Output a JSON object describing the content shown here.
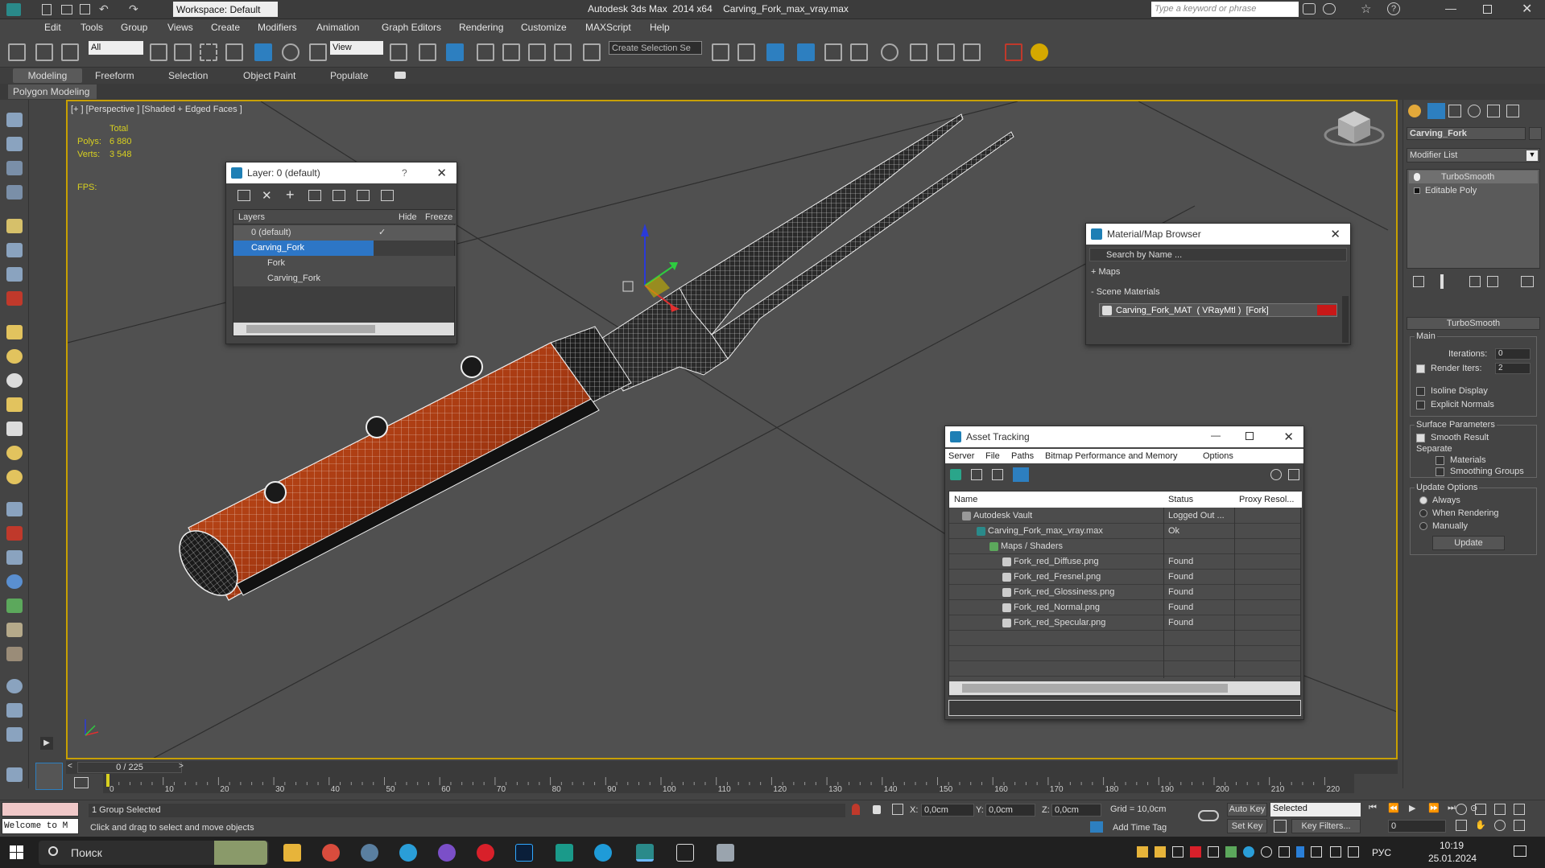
{
  "titlebar": {
    "workspace": "Workspace: Default",
    "title": "Autodesk 3ds Max  2014 x64    Carving_Fork_max_vray.max",
    "search_placeholder": "Type a keyword or phrase"
  },
  "menu": [
    "Edit",
    "Tools",
    "Group",
    "Views",
    "Create",
    "Modifiers",
    "Animation",
    "Graph Editors",
    "Rendering",
    "Customize",
    "MAXScript",
    "Help"
  ],
  "toolbar": {
    "filter": "All",
    "view": "View",
    "selection_set": "Create Selection Se"
  },
  "ribbon": {
    "tabs": [
      "Modeling",
      "Freeform",
      "Selection",
      "Object Paint",
      "Populate"
    ],
    "sub": "Polygon Modeling"
  },
  "viewport": {
    "label": "[+ ] [Perspective ] [Shaded + Edged Faces ]",
    "stats_total": "Total",
    "polys_label": "Polys:",
    "polys_value": "6 880",
    "verts_label": "Verts:",
    "verts_value": "3 548",
    "fps_label": "FPS:"
  },
  "layer_dialog": {
    "title": "Layer: 0 (default)",
    "help": "?",
    "col_layers": "Layers",
    "col_hide": "Hide",
    "col_freeze": "Freeze",
    "rows": [
      "0 (default)",
      "Carving_Fork",
      "Fork",
      "Carving_Fork"
    ]
  },
  "material_browser": {
    "title": "Material/Map Browser",
    "search_placeholder": "Search by Name ...",
    "maps": "+ Maps",
    "scene_materials": "- Scene Materials",
    "material": "Carving_Fork_MAT  ( VRayMtl )  [Fork]",
    "material_color": "#c81818"
  },
  "asset_tracking": {
    "title": "Asset Tracking",
    "menu": [
      "Server",
      "File",
      "Paths",
      "Bitmap Performance and Memory",
      "Options"
    ],
    "col_name": "Name",
    "col_status": "Status",
    "col_proxy": "Proxy Resol...",
    "rows": [
      {
        "name": "Autodesk Vault",
        "status": "Logged Out ..."
      },
      {
        "name": "Carving_Fork_max_vray.max",
        "status": "Ok"
      },
      {
        "name": "Maps / Shaders",
        "status": ""
      },
      {
        "name": "Fork_red_Diffuse.png",
        "status": "Found"
      },
      {
        "name": "Fork_red_Fresnel.png",
        "status": "Found"
      },
      {
        "name": "Fork_red_Glossiness.png",
        "status": "Found"
      },
      {
        "name": "Fork_red_Normal.png",
        "status": "Found"
      },
      {
        "name": "Fork_red_Specular.png",
        "status": "Found"
      }
    ]
  },
  "command_panel": {
    "object_name": "Carving_Fork",
    "modifier_list": "Modifier List",
    "stack": [
      "TurboSmooth",
      "Editable Poly"
    ],
    "rollout_title": "TurboSmooth",
    "main": "Main",
    "iterations_label": "Iterations:",
    "iterations_value": "0",
    "render_iters_label": "Render Iters:",
    "render_iters_value": "2",
    "isoline": "Isoline Display",
    "explicit_normals": "Explicit Normals",
    "surface_params": "Surface Parameters",
    "smooth_result": "Smooth Result",
    "separate": "Separate",
    "materials": "Materials",
    "smoothing_groups": "Smoothing Groups",
    "update_options": "Update Options",
    "always": "Always",
    "when_rendering": "When Rendering",
    "manually": "Manually",
    "update_btn": "Update"
  },
  "timeline": {
    "frame": "0 / 225",
    "ticks": [
      "0",
      "10",
      "20",
      "30",
      "40",
      "50",
      "60",
      "70",
      "80",
      "90",
      "100",
      "110",
      "120",
      "130",
      "140",
      "150",
      "160",
      "170",
      "180",
      "190",
      "200",
      "210",
      "220"
    ]
  },
  "status": {
    "maxscript": "Welcome to M",
    "selected": "1 Group Selected",
    "prompt": "Click and drag to select and move objects",
    "x_label": "X:",
    "x_value": "0,0cm",
    "y_label": "Y:",
    "y_value": "0,0cm",
    "z_label": "Z:",
    "z_value": "0,0cm",
    "grid": "Grid = 10,0cm",
    "add_time_tag": "Add Time Tag",
    "auto_key": "Auto Key",
    "set_key": "Set Key",
    "key_mode": "Selected",
    "key_filters": "Key Filters...",
    "frame_field": "0"
  },
  "taskbar": {
    "search": "Поиск",
    "lang": "РУС",
    "time": "10:19",
    "date": "25.01.2024"
  }
}
